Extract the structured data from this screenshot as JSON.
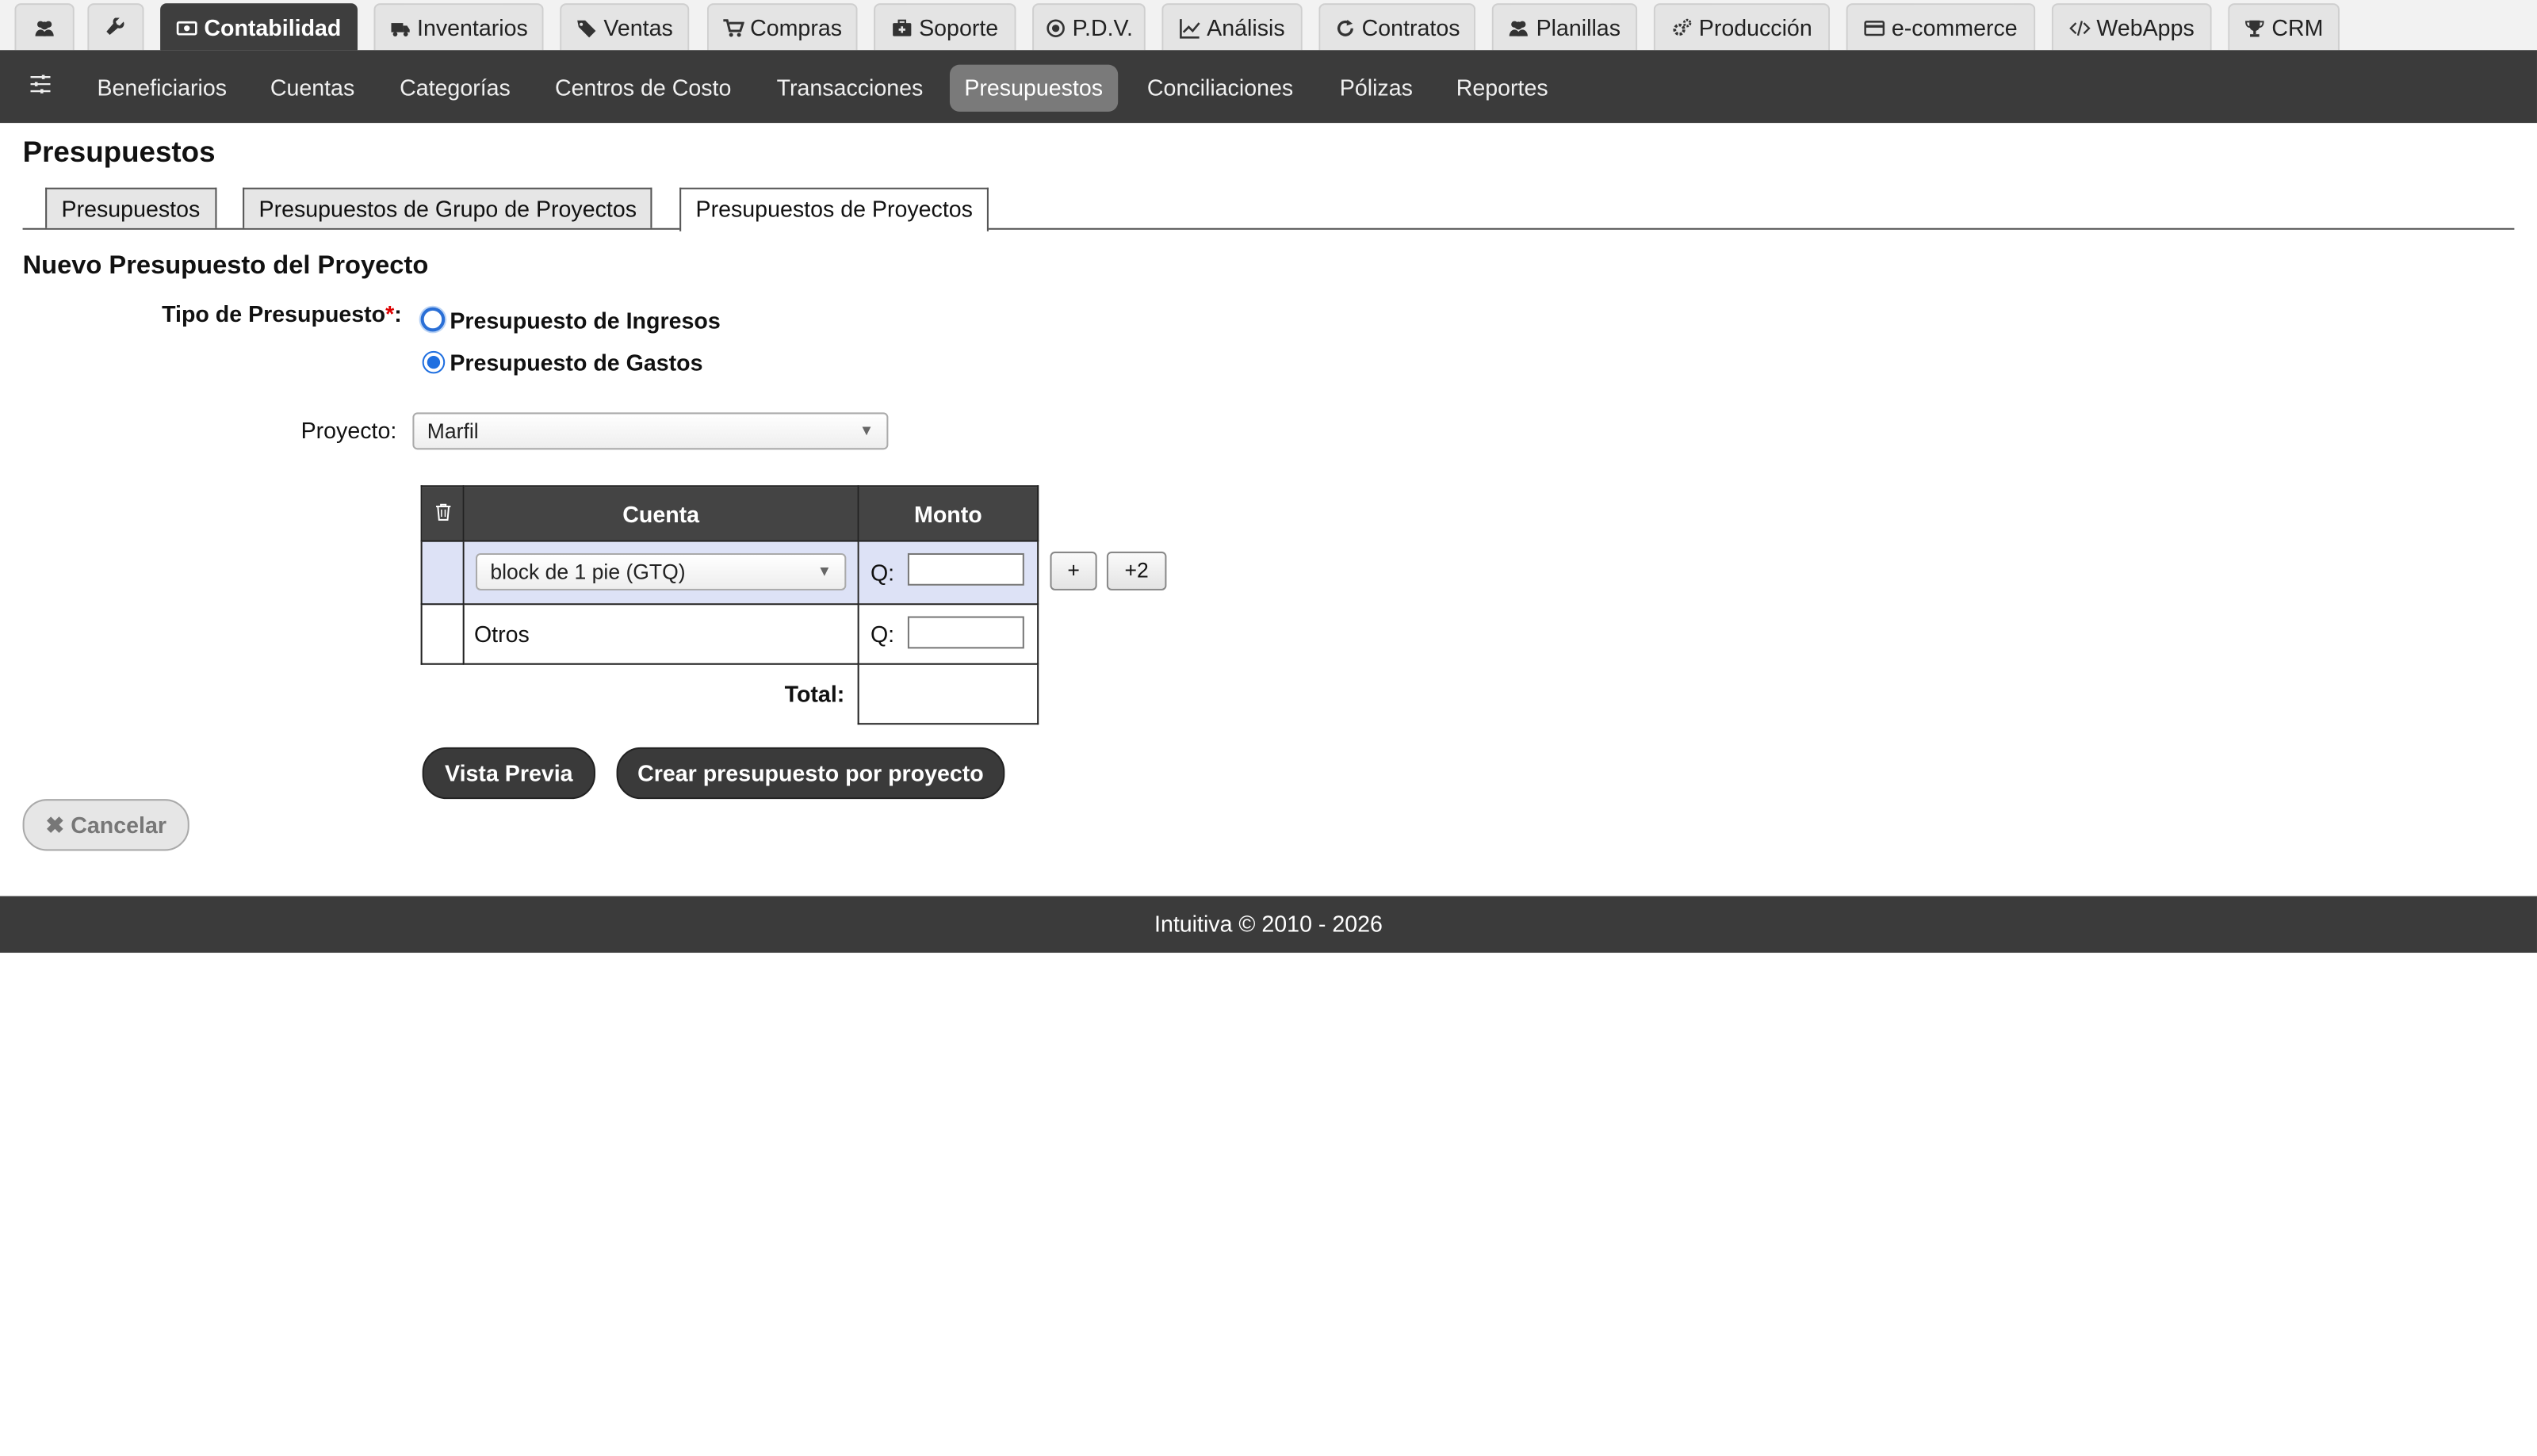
{
  "top_tabs": [
    {
      "label": "",
      "icon": "users-icon"
    },
    {
      "label": "",
      "icon": "wrench-icon"
    },
    {
      "label": "Contabilidad",
      "icon": "money-icon",
      "active": true
    },
    {
      "label": "Inventarios",
      "icon": "truck-icon"
    },
    {
      "label": "Ventas",
      "icon": "tags-icon"
    },
    {
      "label": "Compras",
      "icon": "cart-icon"
    },
    {
      "label": "Soporte",
      "icon": "medkit-icon"
    },
    {
      "label": "P.D.V.",
      "icon": "dot-circle-icon"
    },
    {
      "label": "Análisis",
      "icon": "line-chart-icon"
    },
    {
      "label": "Contratos",
      "icon": "refresh-icon"
    },
    {
      "label": "Planillas",
      "icon": "users-icon"
    },
    {
      "label": "Producción",
      "icon": "cogs-icon"
    },
    {
      "label": "e-commerce",
      "icon": "credit-card-icon"
    },
    {
      "label": "WebApps",
      "icon": "code-icon"
    },
    {
      "label": "CRM",
      "icon": "trophy-icon"
    }
  ],
  "subnav": {
    "icon": "sliders-icon",
    "items": [
      "Beneficiarios",
      "Cuentas",
      "Categorías",
      "Centros de Costo",
      "Transacciones",
      "Presupuestos",
      "Conciliaciones",
      "Pólizas",
      "Reportes"
    ],
    "active": "Presupuestos"
  },
  "page_title": "Presupuestos",
  "page_tabs": [
    "Presupuestos",
    "Presupuestos de Grupo de Proyectos",
    "Presupuestos de Proyectos"
  ],
  "form": {
    "title": "Nuevo Presupuesto del Proyecto",
    "tipo_label": "Tipo de Presupuesto",
    "required_mark": "*",
    "colon": ":",
    "radio_ingresos": "Presupuesto de Ingresos",
    "radio_gastos": "Presupuesto de Gastos",
    "selected_radio": "Presupuesto de Gastos",
    "proyecto_label": "Proyecto:",
    "proyecto_value": "Marfil"
  },
  "table": {
    "col_cuenta": "Cuenta",
    "col_monto": "Monto",
    "row1_cuenta": "block de 1 pie (GTQ)",
    "row2_cuenta": "Otros",
    "currency": "Q:",
    "total_label": "Total:",
    "add_one": "+",
    "add_two": "+2"
  },
  "buttons": {
    "preview": "Vista Previa",
    "create": "Crear presupuesto por proyecto",
    "cancel": "Cancelar"
  },
  "footer": "Intuitiva © 2010 - 2026"
}
